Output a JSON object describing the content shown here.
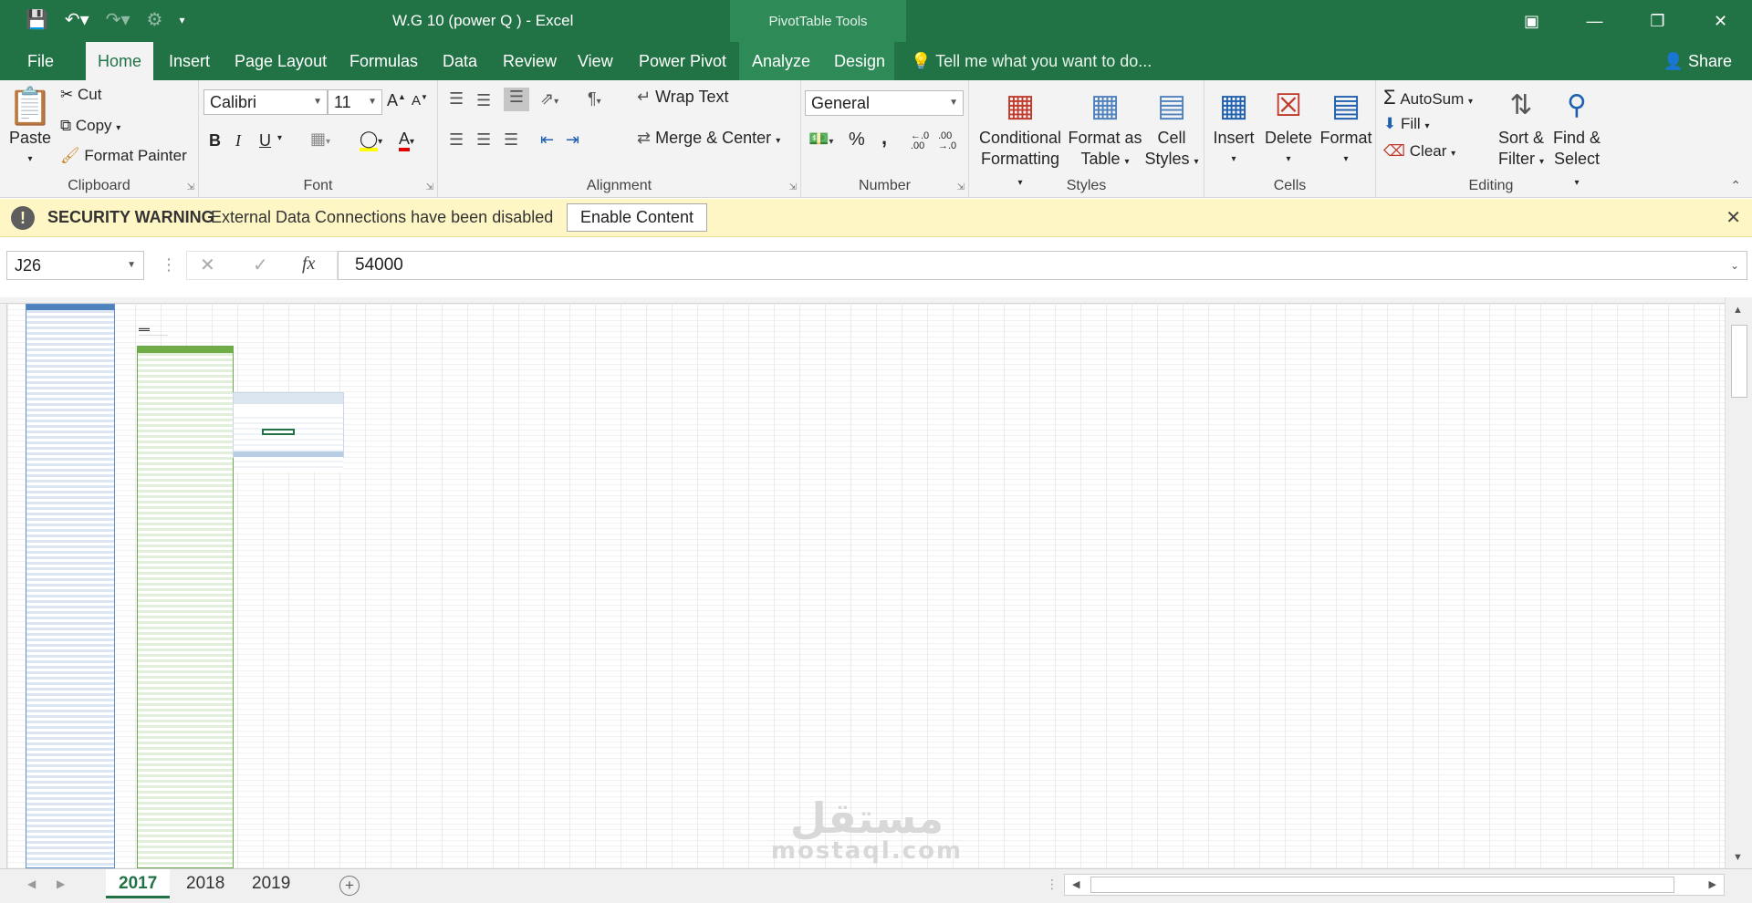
{
  "title_bar": {
    "document_title": "W.G 10 (power Q ) - Excel",
    "contextual_tools": "PivotTable Tools",
    "qat_icons": [
      "save-icon",
      "undo-icon",
      "redo-icon",
      "customize-icon"
    ]
  },
  "tabs": [
    "File",
    "Home",
    "Insert",
    "Page Layout",
    "Formulas",
    "Data",
    "Review",
    "View",
    "Power Pivot",
    "Analyze",
    "Design"
  ],
  "active_tab": "Home",
  "tell_me": "Tell me what you want to do...",
  "share": "Share",
  "ribbon": {
    "clipboard": {
      "label": "Clipboard",
      "paste": "Paste",
      "cut": "Cut",
      "copy": "Copy",
      "format_painter": "Format Painter"
    },
    "font": {
      "label": "Font",
      "font_name": "Calibri",
      "font_size": "11",
      "bold": "B",
      "italic": "I",
      "underline": "U"
    },
    "alignment": {
      "label": "Alignment",
      "wrap_text": "Wrap Text",
      "merge_center": "Merge & Center"
    },
    "number": {
      "label": "Number",
      "format": "General",
      "percent": "%",
      "comma": ",",
      "inc_decimal": "←.0\n.00",
      "dec_decimal": ".00\n→.0"
    },
    "styles": {
      "label": "Styles",
      "conditional_line1": "Conditional",
      "conditional_line2": "Formatting",
      "format_table_line1": "Format as",
      "format_table_line2": "Table",
      "cell_styles_line1": "Cell",
      "cell_styles_line2": "Styles"
    },
    "cells": {
      "label": "Cells",
      "insert": "Insert",
      "delete": "Delete",
      "format": "Format"
    },
    "editing": {
      "label": "Editing",
      "autosum": "AutoSum",
      "fill": "Fill",
      "clear": "Clear",
      "sort_line1": "Sort &",
      "sort_line2": "Filter",
      "find_line1": "Find &",
      "find_line2": "Select"
    }
  },
  "security_warning": {
    "title": "SECURITY WARNING",
    "message": "External Data Connections have been disabled",
    "button": "Enable Content"
  },
  "formula_bar": {
    "name_box": "J26",
    "formula": "54000",
    "fx": "fx"
  },
  "sheets": [
    "2017",
    "2018",
    "2019"
  ],
  "active_sheet": "2017",
  "watermark": {
    "arabic": "مستقل",
    "latin": "mostaql.com"
  },
  "colors": {
    "excel_green": "#217346",
    "warning_bg": "#fff6c6",
    "table_blue": "#4f81bd",
    "table_green": "#70ad47"
  }
}
